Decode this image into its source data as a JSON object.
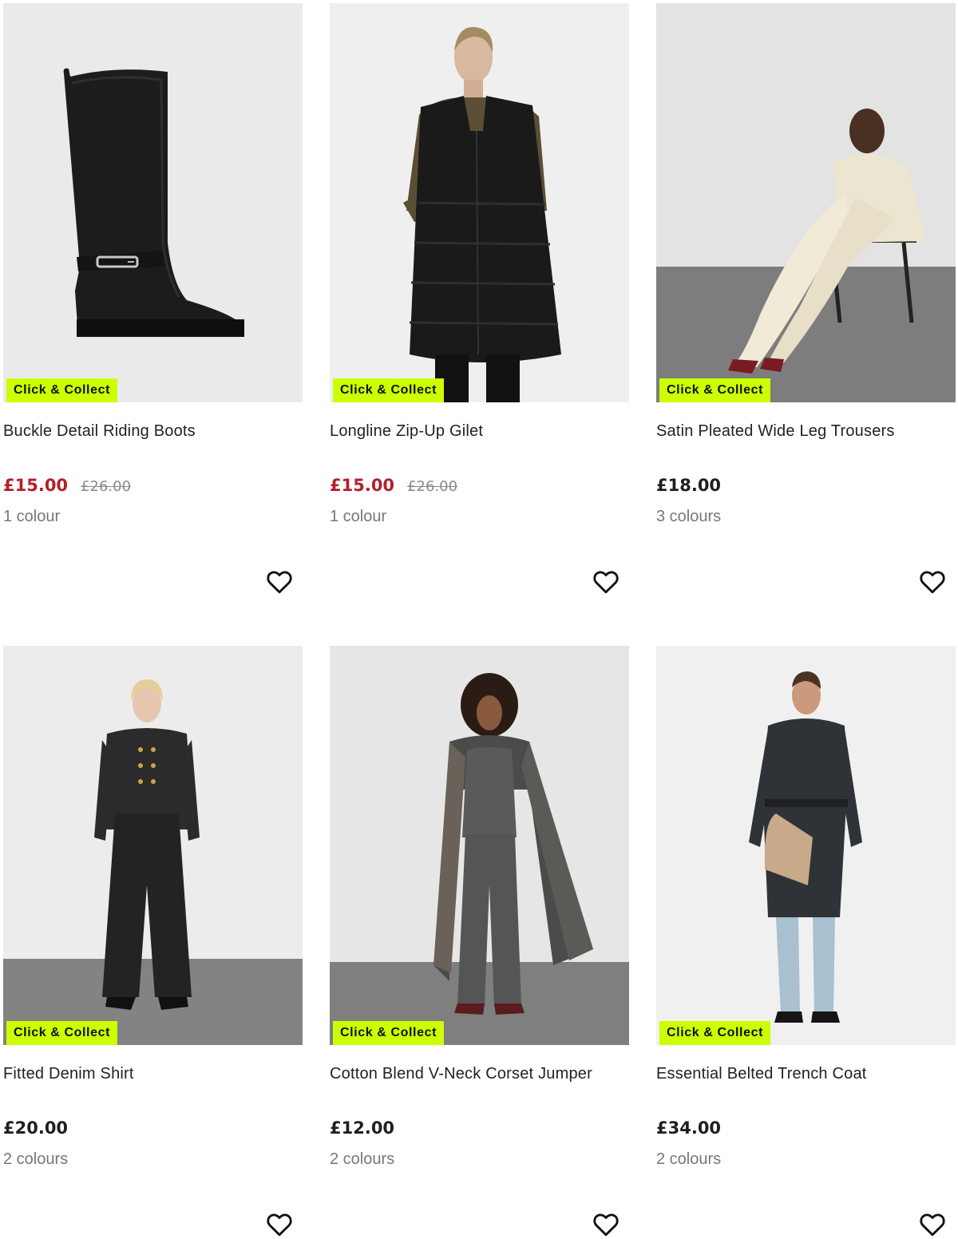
{
  "badge_label": "Click & Collect",
  "colors": {
    "badge_bg": "#ccff00",
    "sale_price": "#b3202a",
    "was_price": "#8a8a8a",
    "text": "#222222"
  },
  "products": [
    {
      "image": "black knee-high riding boot with buckle",
      "name": "Buckle Detail Riding Boots",
      "price": "£15.00",
      "was_price": "£26.00",
      "on_sale": true,
      "colours": "1 colour",
      "wishlist_icon": "heart-outline-icon"
    },
    {
      "image": "model in black longline puffer gilet over khaki knit",
      "name": "Longline Zip-Up Gilet",
      "price": "£15.00",
      "was_price": "£26.00",
      "on_sale": true,
      "colours": "1 colour",
      "wishlist_icon": "heart-outline-icon"
    },
    {
      "image": "model seated in cream satin suit",
      "name": "Satin Pleated Wide Leg Trousers",
      "price": "£18.00",
      "was_price": "",
      "on_sale": false,
      "colours": "3 colours",
      "wishlist_icon": "heart-outline-icon"
    },
    {
      "image": "model in black denim jacket and wide jeans",
      "name": "Fitted Denim Shirt",
      "price": "£20.00",
      "was_price": "",
      "on_sale": false,
      "colours": "2 colours",
      "wishlist_icon": "heart-outline-icon"
    },
    {
      "image": "model in grey knit set with check coat",
      "name": "Cotton Blend V-Neck Corset Jumper",
      "price": "£12.00",
      "was_price": "",
      "on_sale": false,
      "colours": "2 colours",
      "wishlist_icon": "heart-outline-icon"
    },
    {
      "image": "model in black belted trench coat and light jeans",
      "name": "Essential Belted Trench Coat",
      "price": "£34.00",
      "was_price": "",
      "on_sale": false,
      "colours": "2 colours",
      "wishlist_icon": "heart-outline-icon"
    }
  ]
}
